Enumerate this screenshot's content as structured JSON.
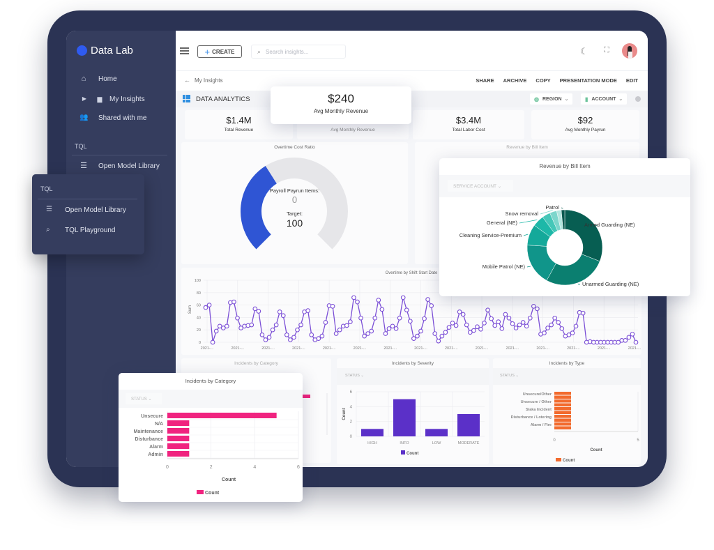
{
  "app": {
    "name": "Data Lab",
    "brand_color": "#2f5bf0"
  },
  "sidebar": {
    "items": [
      {
        "label": "Home",
        "icon": "home-icon"
      },
      {
        "label": "My Insights",
        "icon": "folder-icon",
        "expand_icon": "caret-right-icon"
      },
      {
        "label": "Shared with me",
        "icon": "people-icon"
      }
    ],
    "tql_section": {
      "label": "TQL",
      "items": [
        {
          "label": "Open Model Library",
          "icon": "database-icon"
        }
      ]
    }
  },
  "tql_popup": {
    "label": "TQL",
    "items": [
      {
        "label": "Open Model Library",
        "icon": "database-icon"
      },
      {
        "label": "TQL Playground",
        "icon": "database-search-icon"
      }
    ]
  },
  "topbar": {
    "create_label": "CREATE",
    "search_placeholder": "Search insights...",
    "icons": [
      "menu-icon",
      "dark-mode-icon",
      "fullscreen-icon",
      "avatar"
    ]
  },
  "breadcrumb": {
    "back_label": "My Insights"
  },
  "actions": [
    "SHARE",
    "ARCHIVE",
    "COPY",
    "PRESENTATION MODE",
    "EDIT"
  ],
  "dashboard": {
    "title": "DATA ANALYTICS",
    "filters": [
      {
        "label": "REGION"
      },
      {
        "label": "ACCOUNT"
      }
    ]
  },
  "kpis": [
    {
      "value": "$1.4M",
      "label": "Total Revenue"
    },
    {
      "value": "$240",
      "label": "Avg Monthly Revenue"
    },
    {
      "value": "$3.4M",
      "label": "Total Labor Cost"
    },
    {
      "value": "$92",
      "label": "Avg Monthly Payrun"
    }
  ],
  "highlight_kpi": {
    "value": "$240",
    "label": "Avg Monthly Revenue"
  },
  "gauge": {
    "title": "Overtime Cost Ratio",
    "items_label": "Payroll Payrun Items:",
    "items_value": "0",
    "target_label": "Target:",
    "target_value": "100",
    "fill_fraction": 0.38,
    "fill_color": "#2f55d4",
    "track_color": "#e6e6e9"
  },
  "revenue_bg_title": "Revenue by Bill Item",
  "chart_data": [
    {
      "type": "pie",
      "title": "Revenue by Bill Item",
      "filter_label": "SERVICE ACCOUNT",
      "slices": [
        {
          "label": "Armed Guarding (NE)",
          "value": 31,
          "color": "#075e52"
        },
        {
          "label": "Unarmed Guarding (NE)",
          "value": 27,
          "color": "#0b7f70"
        },
        {
          "label": "Mobile Patrol (NE)",
          "value": 18,
          "color": "#10958a"
        },
        {
          "label": "Cleaning Service-Premium",
          "value": 9,
          "color": "#14a99a"
        },
        {
          "label": "General (NE)",
          "value": 5,
          "color": "#1db8a8"
        },
        {
          "label": "",
          "value": 3.5,
          "color": "#45c7b8"
        },
        {
          "label": "Snow removal",
          "value": 3,
          "color": "#7dd6cc"
        },
        {
          "label": "",
          "value": 2,
          "color": "#b2e6df"
        },
        {
          "label": "Patrol",
          "value": 1.5,
          "color": "#0a5a50"
        }
      ]
    },
    {
      "type": "line",
      "title": "Overtime by Shift Start Date",
      "ylabel": "Sum",
      "ylim": [
        0,
        100
      ],
      "yticks": [
        0,
        20,
        40,
        60,
        80,
        100
      ],
      "xtick_label": "2021-...",
      "xtick_count": 15,
      "color": "#7b4fd6",
      "values": [
        56,
        60,
        0,
        18,
        26,
        23,
        26,
        64,
        65,
        39,
        23,
        26,
        27,
        28,
        54,
        50,
        12,
        4,
        8,
        20,
        28,
        49,
        43,
        12,
        4,
        8,
        20,
        28,
        49,
        51,
        12,
        4,
        6,
        10,
        32,
        59,
        58,
        14,
        20,
        26,
        27,
        33,
        72,
        65,
        39,
        10,
        14,
        18,
        39,
        68,
        53,
        14,
        22,
        26,
        22,
        39,
        72,
        52,
        34,
        6,
        10,
        18,
        38,
        69,
        59,
        14,
        2,
        10,
        16,
        24,
        31,
        27,
        49,
        45,
        28,
        16,
        19,
        25,
        21,
        31,
        52,
        38,
        27,
        33,
        22,
        45,
        39,
        30,
        23,
        28,
        32,
        26,
        39,
        58,
        54,
        13,
        15,
        23,
        28,
        39,
        32,
        22,
        10,
        12,
        15,
        26,
        48,
        47,
        0,
        1,
        0,
        0,
        0,
        0,
        0,
        0,
        0,
        0,
        3,
        3,
        8,
        13,
        0
      ]
    },
    {
      "type": "bar",
      "orientation": "horizontal",
      "title": "Incidents by Category",
      "filter_label": "STATUS",
      "categories": [
        "Unsecure",
        "N/A",
        "Maintenance",
        "Disturbance",
        "Alarm",
        "Admin"
      ],
      "values": [
        5,
        1,
        1,
        1,
        1,
        1
      ],
      "xlabel": "Count",
      "xlim": [
        0,
        6
      ],
      "xticks": [
        0,
        2,
        4,
        6
      ],
      "legend": "Count",
      "color": "#f0237f"
    },
    {
      "type": "bar",
      "title": "Incidents by Severity",
      "filter_label": "STATUS",
      "categories": [
        "HIGH",
        "INFO",
        "LOW",
        "MODERATE"
      ],
      "values": [
        1,
        5,
        1,
        3
      ],
      "ylabel": "Count",
      "ylim": [
        0,
        6
      ],
      "yticks": [
        0,
        2,
        4,
        6
      ],
      "legend": "Count",
      "color": "#5b30c8"
    },
    {
      "type": "bar",
      "orientation": "horizontal",
      "title": "Incidents by Type",
      "filter_label": "STATUS",
      "categories": [
        "Unsecure/Other",
        "",
        "Unsecure / Other",
        "",
        "Slaka Incident",
        "",
        "Disturbance / Lotering",
        "",
        "Alarm / Fire",
        ""
      ],
      "values": [
        1,
        1,
        1,
        1,
        1,
        1,
        1,
        1,
        1,
        1
      ],
      "xlabel": "Count",
      "xlim": [
        0,
        5
      ],
      "xticks": [
        0,
        5
      ],
      "legend": "Count",
      "color": "#f26b2e"
    }
  ]
}
